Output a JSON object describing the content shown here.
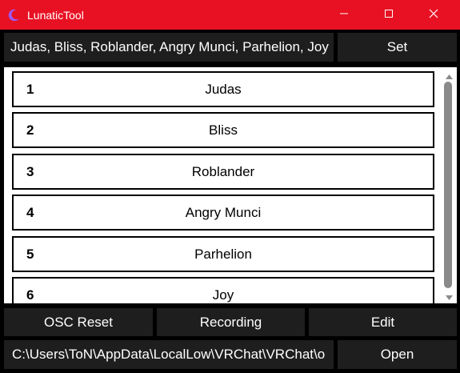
{
  "window": {
    "title": "LunaticTool",
    "accent": "#e81123"
  },
  "top_bar": {
    "names_value": "Judas, Bliss, Roblander, Angry Munci, Parhelion, Joy",
    "set_label": "Set"
  },
  "list": {
    "items": [
      {
        "num": "1",
        "name": "Judas"
      },
      {
        "num": "2",
        "name": "Bliss"
      },
      {
        "num": "3",
        "name": "Roblander"
      },
      {
        "num": "4",
        "name": "Angry Munci"
      },
      {
        "num": "5",
        "name": "Parhelion"
      },
      {
        "num": "6",
        "name": "Joy"
      }
    ]
  },
  "actions": {
    "osc_reset_label": "OSC Reset",
    "recording_label": "Recording",
    "edit_label": "Edit"
  },
  "bottom_bar": {
    "path_value": "C:\\Users\\ToN\\AppData\\LocalLow\\VRChat\\VRChat\\o",
    "open_label": "Open"
  },
  "icons": {
    "app": "crescent-moon-icon",
    "minimize": "minimize-icon",
    "maximize": "maximize-icon",
    "close": "close-icon"
  }
}
